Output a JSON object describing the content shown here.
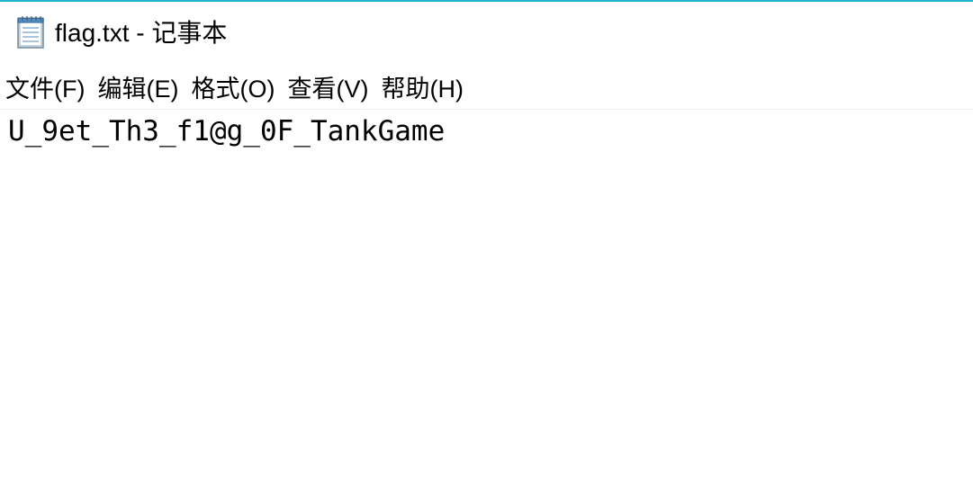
{
  "window": {
    "title": "flag.txt - 记事本",
    "icon": "notepad-icon",
    "accent_color": "#1fb3d0"
  },
  "menu": {
    "items": [
      {
        "label": "文件(F)"
      },
      {
        "label": "编辑(E)"
      },
      {
        "label": "格式(O)"
      },
      {
        "label": "查看(V)"
      },
      {
        "label": "帮助(H)"
      }
    ]
  },
  "editor": {
    "content": "U_9et_Th3_f1@g_0F_TankGame"
  }
}
